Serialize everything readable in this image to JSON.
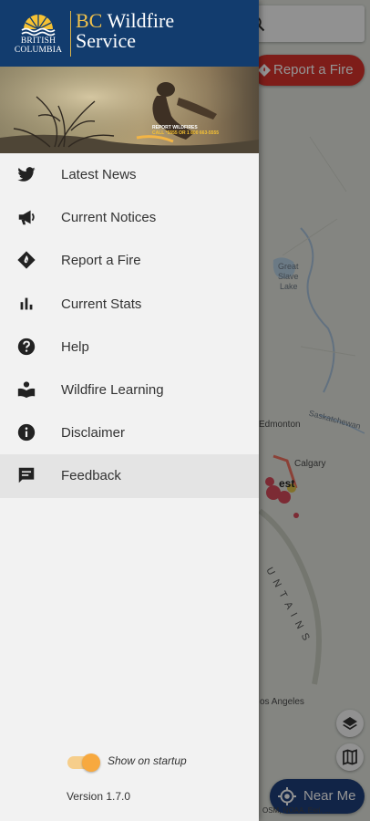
{
  "header": {
    "logo_text_line1": "BRITISH",
    "logo_text_line2": "COLUMBIA",
    "brand_bc": "BC",
    "brand_wildfire": "Wildfire",
    "brand_service": "Service",
    "accent_color": "#f0c14b",
    "background_color": "#123c6e"
  },
  "banner": {
    "caption_line1": "REPORT WILDFIRES",
    "caption_line2": "CALL *5555 OR 1 800 663-5555"
  },
  "menu": {
    "items": [
      {
        "label": "Latest News",
        "icon": "twitter-icon"
      },
      {
        "label": "Current Notices",
        "icon": "megaphone-icon"
      },
      {
        "label": "Report a Fire",
        "icon": "report-fire-icon"
      },
      {
        "label": "Current Stats",
        "icon": "bar-chart-icon"
      },
      {
        "label": "Help",
        "icon": "help-icon"
      },
      {
        "label": "Wildfire Learning",
        "icon": "learning-icon"
      },
      {
        "label": "Disclaimer",
        "icon": "info-icon"
      },
      {
        "label": "Feedback",
        "icon": "feedback-icon"
      }
    ],
    "active_index": 7
  },
  "footer": {
    "show_on_startup_label": "Show on startup",
    "show_on_startup": true,
    "version": "Version 1.7.0"
  },
  "map": {
    "report_button_label": "Report a Fire",
    "near_me_label": "Near Me",
    "labels": {
      "great_slave_lake_1": "Great",
      "great_slave_lake_2": "Slave",
      "great_slave_lake_3": "Lake",
      "edmonton": "Edmonton",
      "saskatchewan": "Saskatchewan",
      "calgary": "Calgary",
      "west": "est",
      "mountains": "U N T A I N S",
      "los_angeles": "os Angeles"
    },
    "attribution": "OSM, NOAA, Esri, ..."
  }
}
